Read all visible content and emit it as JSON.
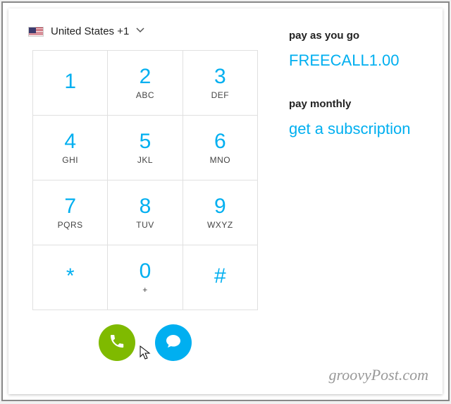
{
  "country": {
    "label": "United States +1"
  },
  "dialpad": {
    "keys": [
      [
        {
          "digit": "1",
          "letters": ""
        },
        {
          "digit": "2",
          "letters": "ABC"
        },
        {
          "digit": "3",
          "letters": "DEF"
        }
      ],
      [
        {
          "digit": "4",
          "letters": "GHI"
        },
        {
          "digit": "5",
          "letters": "JKL"
        },
        {
          "digit": "6",
          "letters": "MNO"
        }
      ],
      [
        {
          "digit": "7",
          "letters": "PQRS"
        },
        {
          "digit": "8",
          "letters": "TUV"
        },
        {
          "digit": "9",
          "letters": "WXYZ"
        }
      ],
      [
        {
          "digit": "*",
          "letters": ""
        },
        {
          "digit": "0",
          "letters": "+"
        },
        {
          "digit": "#",
          "letters": ""
        }
      ]
    ]
  },
  "sidebar": {
    "payg_label": "pay as you go",
    "payg_value": "FREECALL1.00",
    "monthly_label": "pay monthly",
    "monthly_link": "get a subscription"
  },
  "watermark": "groovyPost.com"
}
